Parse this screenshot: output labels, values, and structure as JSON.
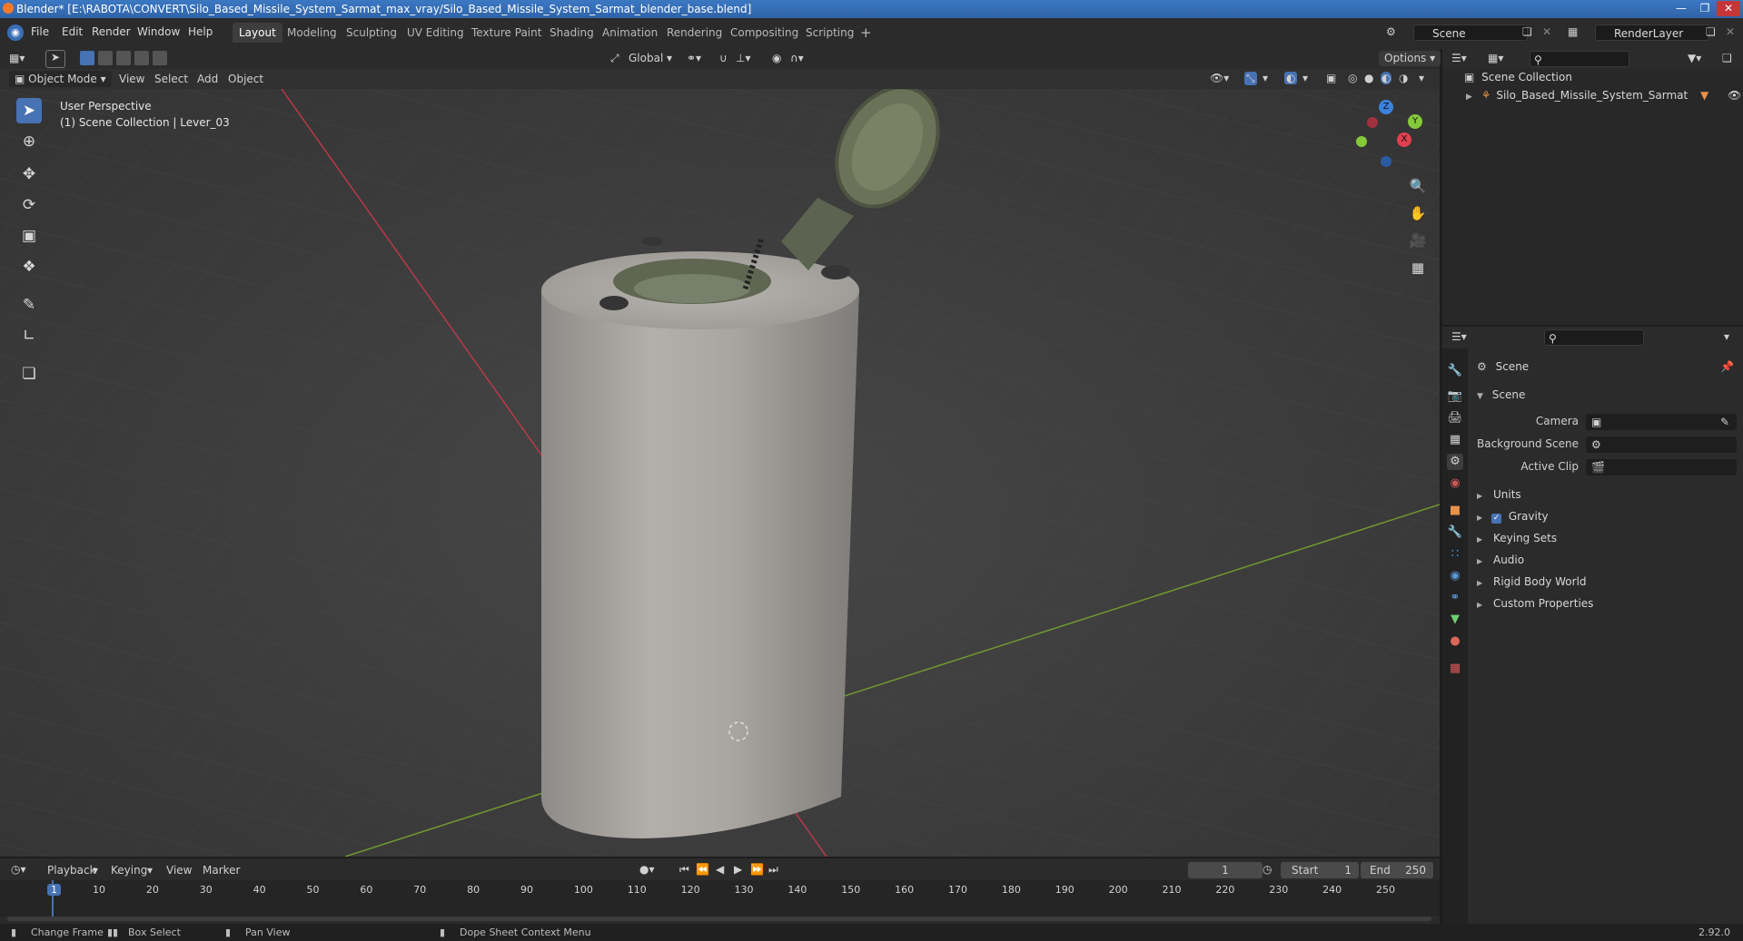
{
  "window": {
    "title": "Blender* [E:\\RABOTA\\CONVERT\\Silo_Based_Missile_System_Sarmat_max_vray/Silo_Based_Missile_System_Sarmat_blender_base.blend]"
  },
  "menu": {
    "items": [
      "File",
      "Edit",
      "Render",
      "Window",
      "Help"
    ]
  },
  "workspaces": {
    "tabs": [
      "Layout",
      "Modeling",
      "Sculpting",
      "UV Editing",
      "Texture Paint",
      "Shading",
      "Animation",
      "Rendering",
      "Compositing",
      "Scripting"
    ],
    "active": "Layout",
    "add_label": "+"
  },
  "scene_selector": {
    "value": "Scene"
  },
  "renderlayer_selector": {
    "value": "RenderLayer"
  },
  "viewport_header": {
    "transform_orientation": "Global",
    "options_label": "Options",
    "mode": "Object Mode",
    "menus": [
      "View",
      "Select",
      "Add",
      "Object"
    ]
  },
  "viewport": {
    "overlay_line1": "User Perspective",
    "overlay_line2": "(1) Scene Collection | Lever_03",
    "gizmo_axes": {
      "x": "X",
      "y": "Y",
      "z": "Z"
    }
  },
  "outliner": {
    "search_placeholder": "",
    "root": "Scene Collection",
    "items": [
      {
        "label": "Silo_Based_Missile_System_Sarmat"
      }
    ]
  },
  "properties": {
    "context_title": "Scene",
    "panel_title": "Scene",
    "fields": [
      {
        "label": "Camera",
        "value": ""
      },
      {
        "label": "Background Scene",
        "value": ""
      },
      {
        "label": "Active Clip",
        "value": ""
      }
    ],
    "subpanels": [
      "Units",
      "Gravity",
      "Keying Sets",
      "Audio",
      "Rigid Body World",
      "Custom Properties"
    ],
    "gravity_checked": true
  },
  "timeline": {
    "menus": [
      "Playback",
      "Keying",
      "View",
      "Marker"
    ],
    "current_frame": "1",
    "start_label": "Start",
    "start": "1",
    "end_label": "End",
    "end": "250",
    "ticks": [
      "1",
      "10",
      "20",
      "30",
      "40",
      "50",
      "60",
      "70",
      "80",
      "90",
      "100",
      "110",
      "120",
      "130",
      "140",
      "150",
      "160",
      "170",
      "180",
      "190",
      "200",
      "210",
      "220",
      "230",
      "240",
      "250"
    ]
  },
  "statusbar": {
    "items": [
      "Change Frame",
      "Box Select",
      "Pan View",
      "Dope Sheet Context Menu"
    ],
    "version": "2.92.0"
  },
  "colors": {
    "accent": "#4772b3",
    "title_bar": "#3c78c3",
    "axis_x": "#e0404f",
    "axis_y": "#85c93b",
    "axis_z": "#3b82e0"
  }
}
